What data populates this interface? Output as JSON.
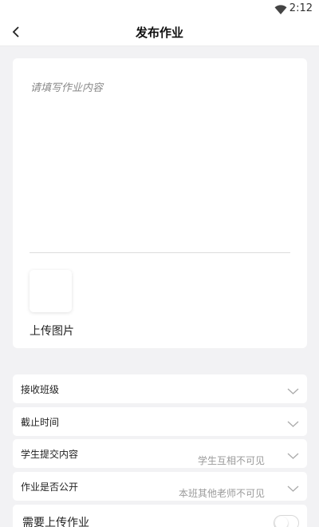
{
  "status_bar": {
    "time": "2:12",
    "wifi_icon": "wifi-icon"
  },
  "nav": {
    "title": "发布作业",
    "back_icon": "chevron-left-icon"
  },
  "editor": {
    "placeholder": "请填写作业内容",
    "upload_label": "上传图片"
  },
  "form_rows": [
    {
      "label": "接收班级",
      "value": ""
    },
    {
      "label": "截止时间",
      "value": ""
    },
    {
      "label": "学生提交内容",
      "value": "学生互相不可见"
    },
    {
      "label": "作业是否公开",
      "value": "本班其他老师不可见"
    }
  ],
  "toggle_row": {
    "label": "需要上传作业",
    "state": "off"
  }
}
